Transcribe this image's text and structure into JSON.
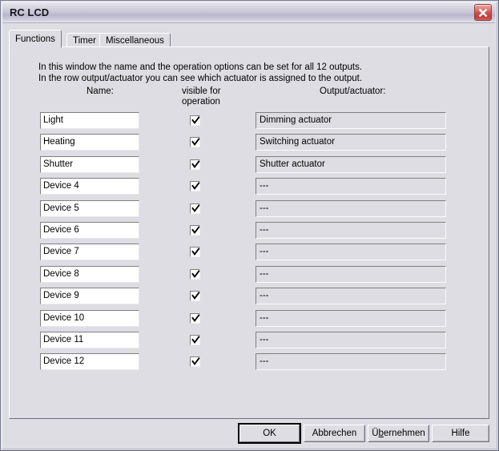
{
  "window": {
    "title": "RC LCD",
    "close_icon": "close-x-icon"
  },
  "tabs": [
    {
      "label": "Functions",
      "active": true
    },
    {
      "label": "Timer",
      "active": false
    },
    {
      "label": "Miscellaneous",
      "active": false
    }
  ],
  "description": {
    "line1": "In this window the name and the operation options can be set for all 12 outputs.",
    "line2": "In the row output/actuator you can see which actuator is assigned to the output."
  },
  "headers": {
    "name": "Name:",
    "visible_line1": "visible for",
    "visible_line2": "operation",
    "output": "Output/actuator:"
  },
  "rows": [
    {
      "name": "Light",
      "visible": true,
      "output": "Dimming actuator"
    },
    {
      "name": "Heating",
      "visible": true,
      "output": "Switching actuator"
    },
    {
      "name": "Shutter",
      "visible": true,
      "output": "Shutter actuator"
    },
    {
      "name": "Device 4",
      "visible": true,
      "output": "---"
    },
    {
      "name": "Device 5",
      "visible": true,
      "output": "---"
    },
    {
      "name": "Device 6",
      "visible": true,
      "output": "---"
    },
    {
      "name": "Device 7",
      "visible": true,
      "output": "---"
    },
    {
      "name": "Device 8",
      "visible": true,
      "output": "---"
    },
    {
      "name": "Device 9",
      "visible": true,
      "output": "---"
    },
    {
      "name": "Device 10",
      "visible": true,
      "output": "---"
    },
    {
      "name": "Device 11",
      "visible": true,
      "output": "---"
    },
    {
      "name": "Device 12",
      "visible": true,
      "output": "---"
    }
  ],
  "buttons": {
    "ok": "OK",
    "cancel": "Abbrechen",
    "apply_before": "Ü",
    "apply_accel": "b",
    "apply_after": "ernehmen",
    "help": "Hilfe"
  },
  "colors": {
    "face": "#dedde3",
    "title_gradient_light": "#e9e8ee",
    "title_gradient_dark": "#b9b7cb",
    "close_red": "#cf4f49",
    "field_white": "#ffffff",
    "text": "#000000"
  }
}
